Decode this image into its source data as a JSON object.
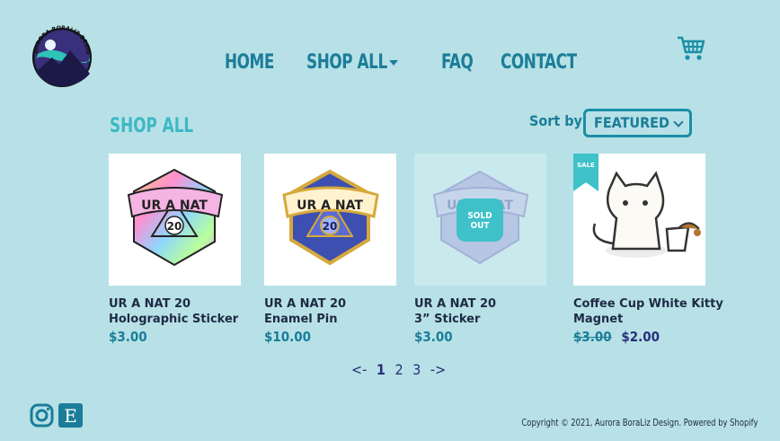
{
  "brand": {
    "logo_text": "AURORA BORALIZ DESIGN"
  },
  "nav": {
    "items": [
      "HOME",
      "SHOP ALL",
      "FAQ",
      "CONTACT"
    ],
    "cart_icon": "shopping-cart-icon"
  },
  "section_title": "SHOP ALL",
  "sort": {
    "label": "Sort by",
    "value": "FEATURED"
  },
  "products": [
    {
      "name_line1": "UR A NAT 20",
      "name_line2": "Holographic Sticker",
      "price": "$3.00",
      "sold_out": false,
      "sale": false
    },
    {
      "name_line1": "UR A NAT 20",
      "name_line2": "Enamel Pin",
      "price": "$10.00",
      "sold_out": false,
      "sale": false
    },
    {
      "name_line1": "UR A NAT 20",
      "name_line2": "3” Sticker",
      "price": "$3.00",
      "sold_out": true,
      "sold_label_1": "SOLD",
      "sold_label_2": "OUT",
      "sale": false
    },
    {
      "name_line1": "Coffee Cup White Kitty",
      "name_line2": "Magnet",
      "price_old": "$3.00",
      "price": "$2.00",
      "sold_out": false,
      "sale": true,
      "sale_label": "SALE"
    }
  ],
  "badge_text": {
    "ur_a_nat": "UR A NAT",
    "twenty": "20"
  },
  "pagination": {
    "prev": "<-",
    "pages": [
      "1",
      "2",
      "3"
    ],
    "current": "1",
    "next": "->"
  },
  "footer": {
    "copyright": "Copyright © 2021, Aurora BoraLiz Design. Powered by Shopify",
    "social": [
      "instagram-icon",
      "etsy-icon"
    ]
  },
  "colors": {
    "background": "#b7e1e6",
    "accent": "#1b7d99",
    "title": "#3eb8c4",
    "price_sale": "#2b2f7a"
  }
}
